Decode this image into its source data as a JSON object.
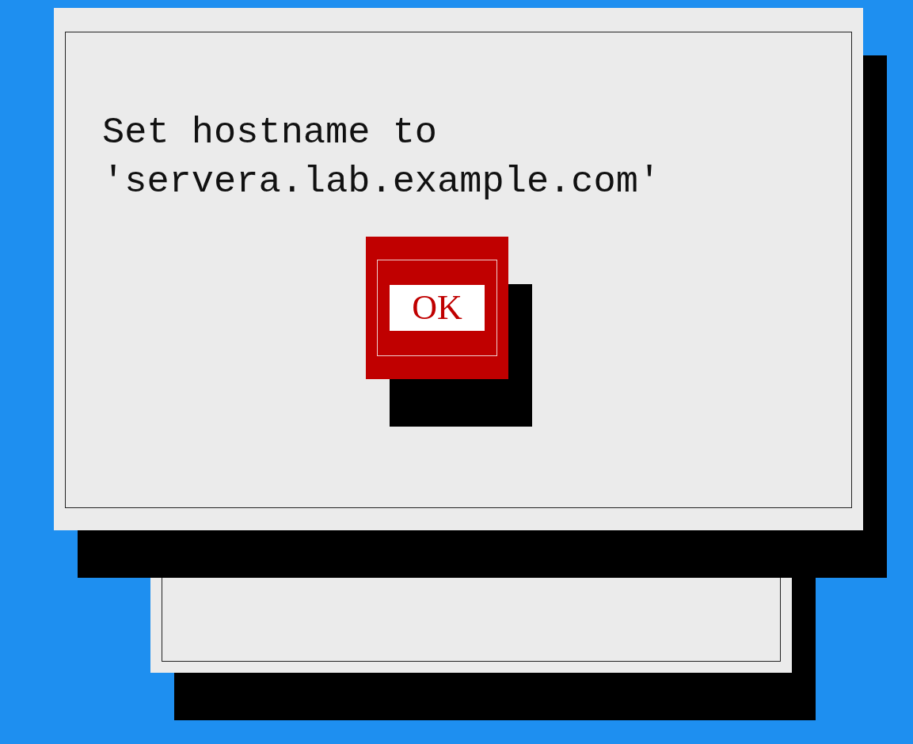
{
  "dialog": {
    "message_lines": [
      "Set hostname to",
      "'servera.lab.example.com'"
    ],
    "buttons": [
      {
        "label": "OK",
        "selected": true
      }
    ]
  }
}
